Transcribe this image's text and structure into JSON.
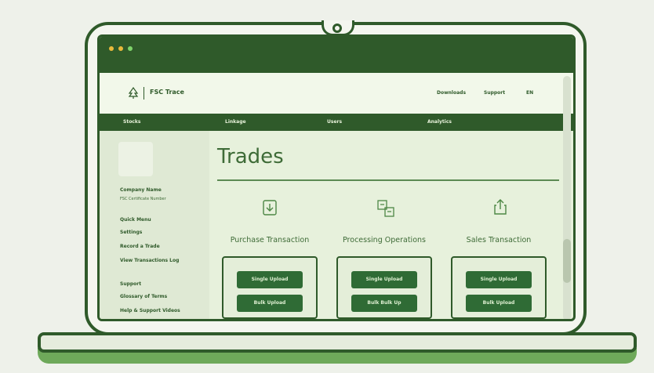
{
  "colors": {
    "accent": "#2f5a2a",
    "background": "#e7f1dc",
    "button": "#2f6b35"
  },
  "window": {
    "dots": [
      "#e9b93b",
      "#e9b93b",
      "#7fd36a"
    ]
  },
  "header": {
    "brand": "FSC Trace",
    "logo_icon": "tree-icon",
    "nav": [
      "Downloads",
      "Support",
      "EN"
    ]
  },
  "navbar": {
    "items": [
      "Stocks",
      "Linkage",
      "Users",
      "Analytics"
    ]
  },
  "sidebar": {
    "company_name": "Company Name",
    "certificate": "FSC Certificate Number",
    "quick_menu": "Quick Menu",
    "items": [
      "Settings",
      "Record a Trade",
      "View Transactions Log"
    ],
    "support_heading": "Support",
    "support_items": [
      "Glossary of Terms",
      "Help & Support Videos"
    ]
  },
  "main": {
    "title": "Trades",
    "columns": [
      {
        "icon": "download-icon",
        "title": "Purchase Transaction",
        "buttons": [
          "Single Upload",
          "Bulk Upload"
        ]
      },
      {
        "icon": "processing-icon",
        "title": "Processing Operations",
        "buttons": [
          "Single Upload",
          "Bulk Bulk Up"
        ]
      },
      {
        "icon": "upload-icon",
        "title": "Sales Transaction",
        "buttons": [
          "Single Upload",
          "Bulk Upload"
        ]
      }
    ]
  }
}
